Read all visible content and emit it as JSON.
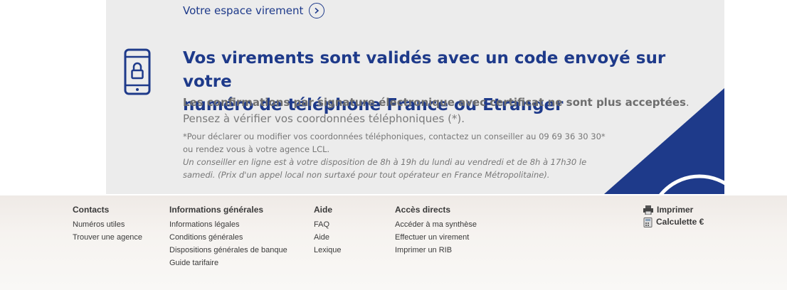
{
  "banner": {
    "link_label": "Votre espace virement",
    "title_line1": "Vos virements sont validés avec un code envoyé sur votre",
    "title_line2": "numéro de téléphone France ou Etranger",
    "confirm_bold": "Les confirmations par signature électronique avec certificat ne sont plus acceptées",
    "confirm_rest": ". Pensez à vérifier vos coordonnées téléphoniques (*).",
    "note_line1": "*Pour déclarer ou modifier vos coordonnées téléphoniques, contactez un conseiller au 09 69 36 30 30*",
    "note_line2": "ou rendez vous à votre agence LCL.",
    "note_line3": "Un conseiller en ligne est à votre disposition de 8h à 19h du lundi au vendredi et de 8h à 17h30 le",
    "note_line4": "samedi. (Prix d'un appel local non surtaxé pour tout opérateur en France Métropolitaine).",
    "icon": "smartphone-lock-icon",
    "accent_color": "#1e3a8a"
  },
  "footer": {
    "contacts": {
      "title": "Contacts",
      "items": [
        "Numéros utiles",
        "Trouver une agence"
      ]
    },
    "infos": {
      "title": "Informations générales",
      "items": [
        "Informations légales",
        "Conditions générales",
        "Dispositions générales de banque",
        "Guide tarifaire"
      ]
    },
    "aide": {
      "title": "Aide",
      "items": [
        "FAQ",
        "Aide",
        "Lexique"
      ]
    },
    "acces": {
      "title": "Accès directs",
      "items": [
        "Accéder à ma synthèse",
        "Effectuer un virement",
        "Imprimer un RIB"
      ]
    },
    "tools": {
      "print_label": "Imprimer",
      "print_icon": "printer-icon",
      "calc_label": "Calculette €",
      "calc_icon": "calculator-icon"
    }
  }
}
